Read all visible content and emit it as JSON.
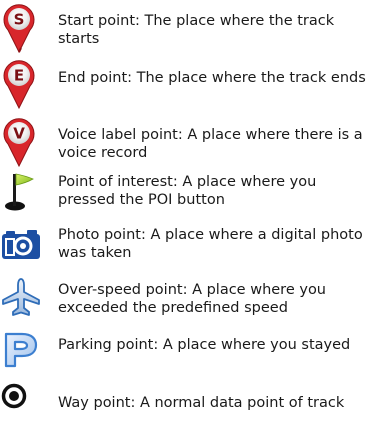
{
  "legend": {
    "items": [
      {
        "icon": "start-pin-icon",
        "letter": "S",
        "text": "Start point: The place where the track starts"
      },
      {
        "icon": "end-pin-icon",
        "letter": "E",
        "text": "End point: The place where the track ends"
      },
      {
        "icon": "voice-pin-icon",
        "letter": "V",
        "text": "Voice label point: A place where there is a voice record"
      },
      {
        "icon": "flag-icon",
        "text": "Point of interest: A place where you pressed the POI button"
      },
      {
        "icon": "camera-icon",
        "text": "Photo point: A place where a digital photo was taken"
      },
      {
        "icon": "airplane-icon",
        "text": "Over-speed point: A place where you exceeded the predefined speed"
      },
      {
        "icon": "parking-icon",
        "text": "Parking point: A place where you stayed"
      },
      {
        "icon": "waypoint-icon",
        "text": "Way point: A normal data point of track"
      }
    ],
    "colors": {
      "pin_red": "#d8262b",
      "pin_dark": "#8e1215",
      "pin_letter": "#7a1014",
      "flag_green": "#a8d82a",
      "camera_blue": "#1d4fa3",
      "airplane_blue": "#2f6db8",
      "parking_blue": "#3c7fd0",
      "waypoint_black": "#111111"
    }
  }
}
